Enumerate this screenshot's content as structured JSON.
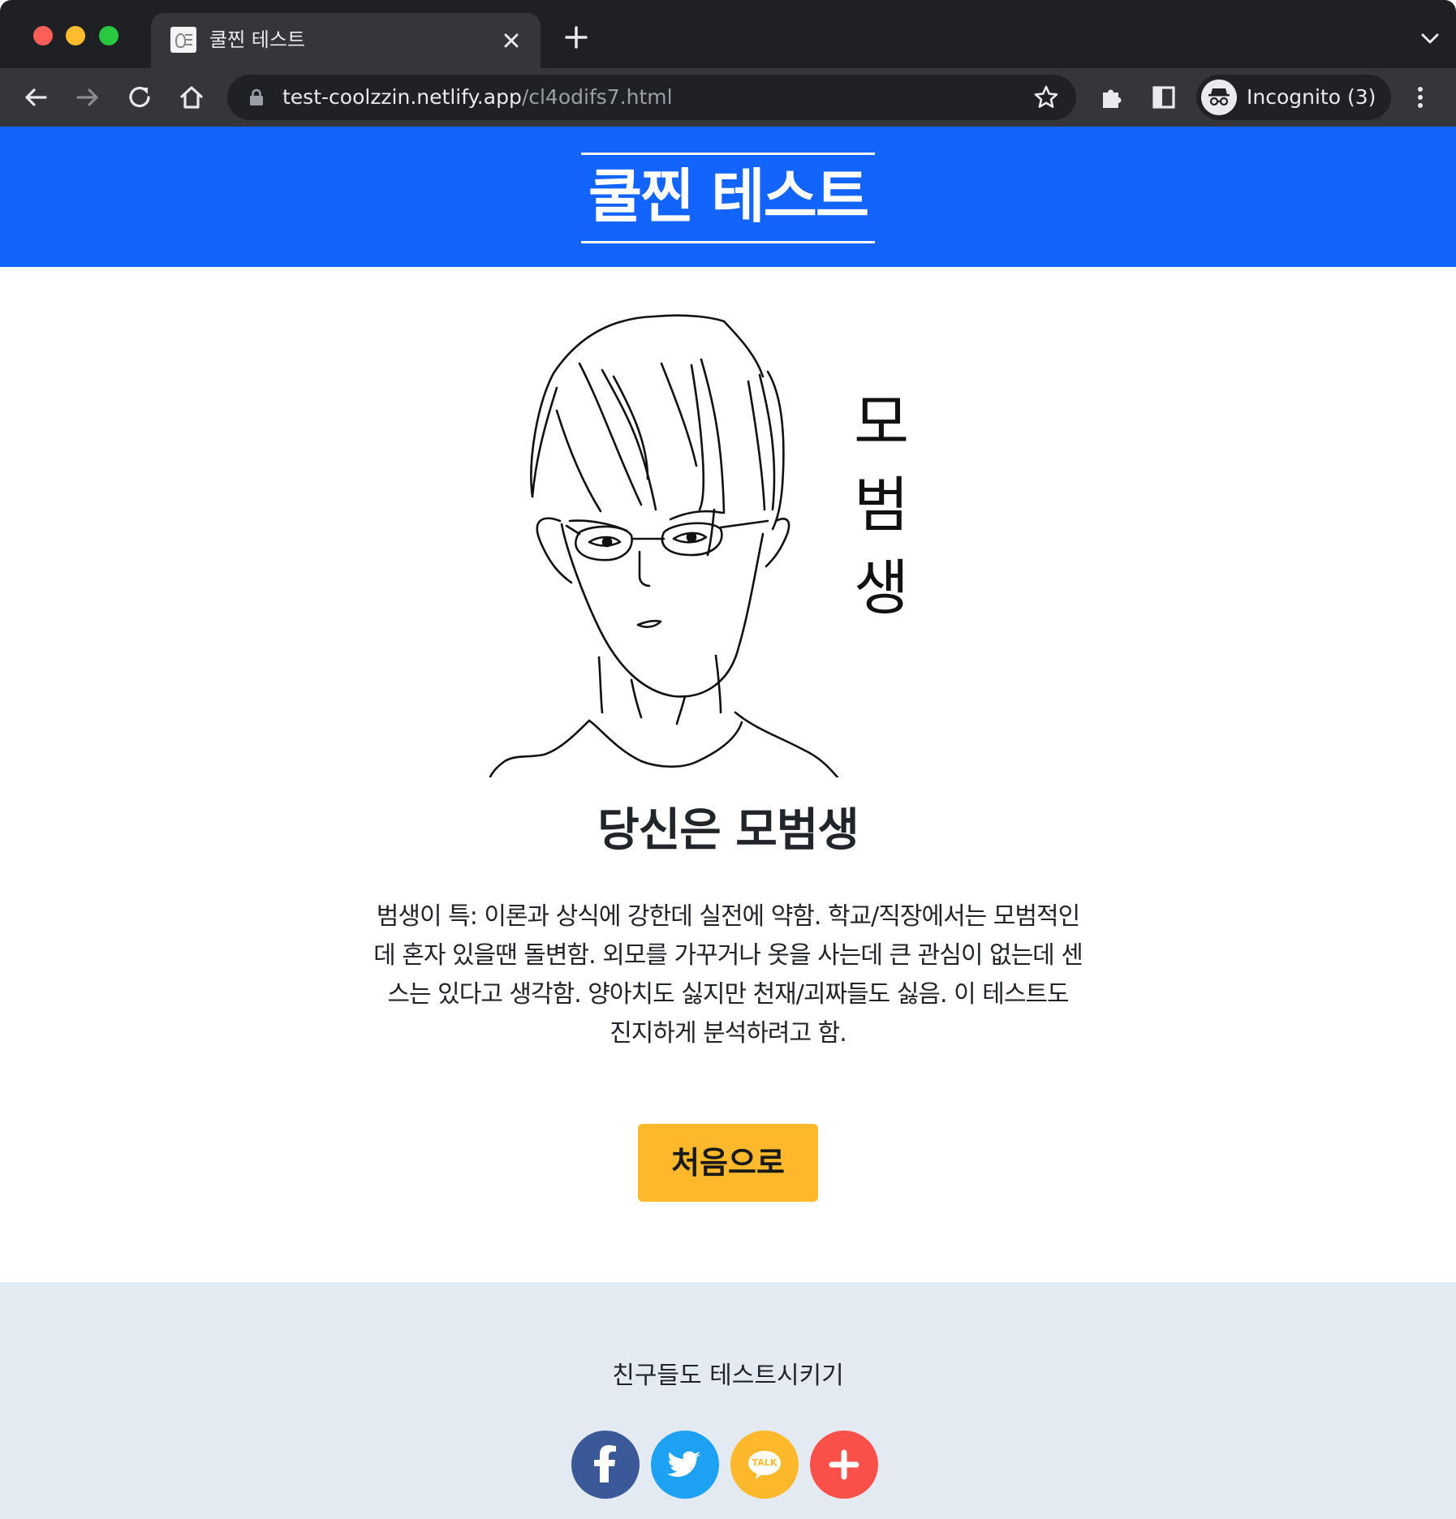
{
  "browser": {
    "tab": {
      "title": "쿨찐 테스트"
    },
    "address": {
      "host": "test-coolzzin.netlify.app",
      "path": "/cl4odifs7.html"
    },
    "profile": {
      "label": "Incognito (3)"
    },
    "icons": {
      "back": "arrow-left-icon",
      "forward": "arrow-right-icon",
      "reload": "reload-icon",
      "home": "home-icon",
      "lock": "lock-icon",
      "star": "star-icon",
      "extensions": "puzzle-icon",
      "sidepanel": "side-panel-icon",
      "incognito": "incognito-icon",
      "menu": "kebab-menu-icon"
    }
  },
  "header": {
    "title": "쿨찐 테스트"
  },
  "result": {
    "vertical_title": [
      "모",
      "범",
      "생"
    ],
    "title": "당신은 모범생",
    "description_lines": [
      "범생이 특: 이론과 상식에 강한데 실전에 약함. 학교/직장에서는 모범적인",
      "데 혼자 있을땐 돌변함. 외모를 가꾸거나 옷을 사는데 큰 관심이 없는데 센",
      "스는 있다고 생각함. 양아치도 싫지만 천재/괴짜들도 싫음. 이 테스트도",
      "진지하게 분석하려고 함."
    ],
    "restart_label": "처음으로"
  },
  "share": {
    "title": "친구들도 테스트시키기",
    "kakao_label": "TALK",
    "buttons": [
      {
        "name": "facebook",
        "color": "#3b5998"
      },
      {
        "name": "twitter",
        "color": "#1da1f2"
      },
      {
        "name": "kakaotalk",
        "color": "#fdb92b"
      },
      {
        "name": "more",
        "color": "#f9504a"
      }
    ]
  },
  "colors": {
    "header_bg": "#1363fd",
    "button_bg": "#fdb92b",
    "footer_bg": "#e4eaf2"
  }
}
